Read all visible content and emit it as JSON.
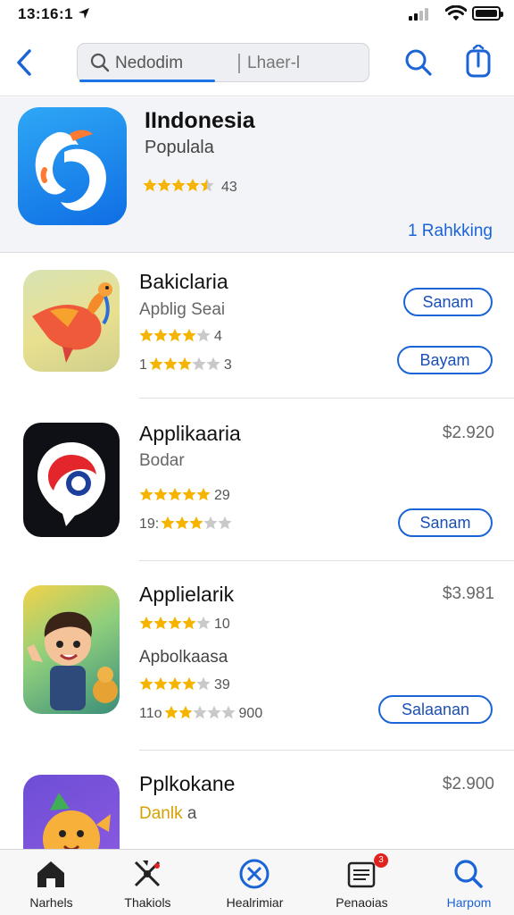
{
  "status_bar": {
    "time": "13:16:1"
  },
  "search": {
    "query": "Nedodim",
    "placeholder": "Lhaer-l"
  },
  "featured": {
    "title": "IIndonesia",
    "subtitle": "Populala",
    "rating_text": "43",
    "stars": 4.5,
    "rank_label": "1 Rahkking"
  },
  "apps": [
    {
      "name": "Bakiclaria",
      "category": "Apblig Seai",
      "rating1_text": "4",
      "rating1_stars": 4,
      "rating2_prefix": "1",
      "rating2_text": "3",
      "rating2_stars": 3,
      "button1": "Sanam",
      "button2": "Bayam"
    },
    {
      "name": "Applikaaria",
      "category": "Bodar",
      "price": "$2.920",
      "rating1_text": "29",
      "rating1_stars": 5,
      "rating2_prefix": "19:",
      "rating2_stars": 3,
      "button1": "Sanam"
    },
    {
      "name": "Applielarik",
      "price": "$3.981",
      "rating1_text": "10",
      "rating1_stars": 4,
      "category": "Apbolkaasa",
      "rating2_text": "39",
      "rating2_stars": 4,
      "rating3_prefix": "11o",
      "rating3_text": "900",
      "rating3_stars": 2,
      "button1": "Salaanan"
    },
    {
      "name": "Pplkokane",
      "category": "Danlk",
      "category_suffix": "a",
      "price": "$2.900"
    }
  ],
  "tabs": [
    {
      "label": "Narhels",
      "icon": "home-icon"
    },
    {
      "label": "Thakiols",
      "icon": "tools-icon"
    },
    {
      "label": "Healrimiar",
      "icon": "circle-x-icon"
    },
    {
      "label": "Penaoias",
      "icon": "news-icon",
      "badge": "3"
    },
    {
      "label": "Harpom",
      "icon": "search-icon",
      "active": true
    }
  ],
  "colors": {
    "accent": "#1a64d6",
    "star": "#f5b400",
    "star_empty": "#c9c9c9"
  }
}
